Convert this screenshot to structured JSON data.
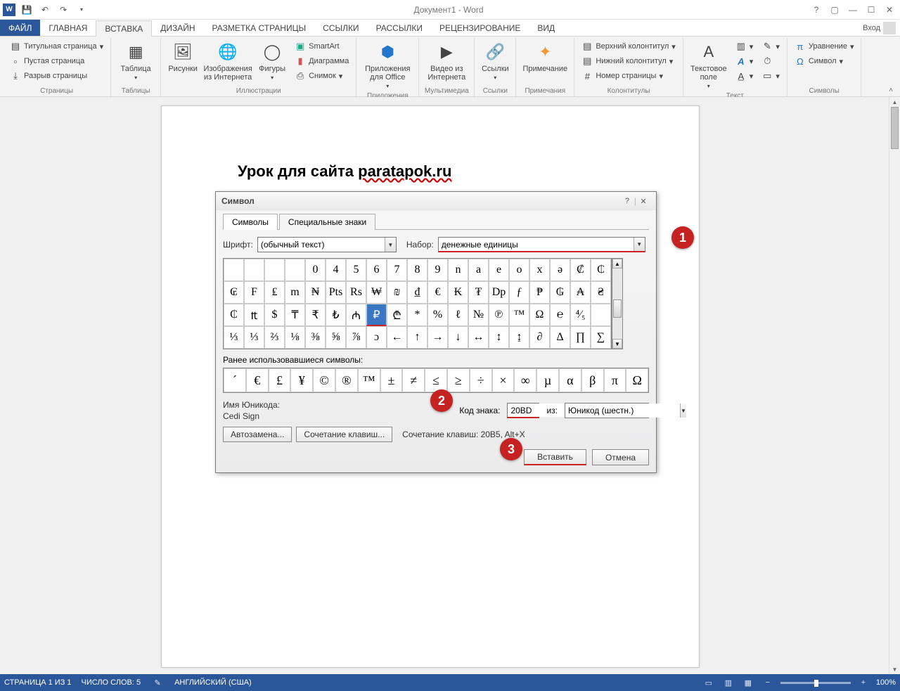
{
  "title": "Документ1 - Word",
  "signin": "Вход",
  "tabs": [
    "ФАЙЛ",
    "ГЛАВНАЯ",
    "ВСТАВКА",
    "ДИЗАЙН",
    "РАЗМЕТКА СТРАНИЦЫ",
    "ССЫЛКИ",
    "РАССЫЛКИ",
    "РЕЦЕНЗИРОВАНИЕ",
    "ВИД"
  ],
  "active_tab": 2,
  "ribbon": {
    "g1": {
      "label": "Страницы",
      "items": [
        "Титульная страница",
        "Пустая страница",
        "Разрыв страницы"
      ]
    },
    "g2": {
      "label": "Таблицы",
      "btn": "Таблица"
    },
    "g3": {
      "label": "Иллюстрации",
      "b1": "Рисунки",
      "b2": "Изображения из Интернета",
      "b3": "Фигуры",
      "i1": "SmartArt",
      "i2": "Диаграмма",
      "i3": "Снимок"
    },
    "g4": {
      "label": "Приложения",
      "btn": "Приложения для Office"
    },
    "g5": {
      "label": "Мультимедиа",
      "btn": "Видео из Интернета"
    },
    "g6": {
      "label": "Ссылки",
      "btn": "Ссылки"
    },
    "g7": {
      "label": "Примечания",
      "btn": "Примечание"
    },
    "g8": {
      "label": "Колонтитулы",
      "i1": "Верхний колонтитул",
      "i2": "Нижний колонтитул",
      "i3": "Номер страницы"
    },
    "g9": {
      "label": "Текст",
      "btn": "Текстовое поле"
    },
    "g10": {
      "label": "Символы",
      "i1": "Уравнение",
      "i2": "Символ"
    }
  },
  "doc": {
    "text1": "Урок для сайта ",
    "text2": "paratapok.ru"
  },
  "dialog": {
    "title": "Символ",
    "tabs": [
      "Символы",
      "Специальные знаки"
    ],
    "font_label": "Шрифт:",
    "font_value": "(обычный текст)",
    "set_label": "Набор:",
    "set_value": "денежные единицы",
    "grid": [
      [
        "",
        "",
        "",
        "",
        "0",
        "4",
        "5",
        "6",
        "7",
        "8",
        "9",
        "n",
        "a",
        "e",
        "o",
        "x",
        "ə",
        "₡",
        "₵"
      ],
      [
        "₢",
        "F",
        "₤",
        "m",
        "₦",
        "Pts",
        "Rs",
        "₩",
        "₪",
        "₫",
        "€",
        "₭",
        "₮",
        "Dp",
        "ƒ",
        "₱",
        "₲",
        "₳",
        "₴"
      ],
      [
        "₵",
        "₶",
        "$",
        "₸",
        "₹",
        "₺",
        "₼",
        "₾",
        "₾",
        "*",
        "%",
        "ℓ",
        "№",
        "℗",
        "™",
        "Ω",
        "℮",
        "⁴⁄₅",
        ""
      ],
      [
        "⅓",
        "⅓",
        "⅔",
        "⅛",
        "⅜",
        "⅝",
        "⅞",
        "ɔ",
        "←",
        "↑",
        "→",
        "↓",
        "↔",
        "↕",
        "↨",
        "∂",
        "Δ",
        "∏",
        "∑"
      ]
    ],
    "grid_selected": {
      "row": 2,
      "col": 7,
      "char": "₽"
    },
    "recent_label": "Ранее использовавшиеся символы:",
    "recent": [
      "´",
      "€",
      "£",
      "¥",
      "©",
      "®",
      "™",
      "±",
      "≠",
      "≤",
      "≥",
      "÷",
      "×",
      "∞",
      "µ",
      "α",
      "β",
      "π",
      "Ω"
    ],
    "uname_label": "Имя Юникода:",
    "uname_value": "Cedi Sign",
    "code_label": "Код знака:",
    "code_value": "20BD",
    "from_label": "из:",
    "from_value": "Юникод (шестн.)",
    "autocorrect": "Автозамена...",
    "shortcut_btn": "Сочетание клавиш...",
    "shortcut_text": "Сочетание клавиш: 20B5, Alt+X",
    "insert": "Вставить",
    "cancel": "Отмена"
  },
  "callouts": [
    "1",
    "2",
    "3"
  ],
  "status": {
    "page": "СТРАНИЦА 1 ИЗ 1",
    "words": "ЧИСЛО СЛОВ: 5",
    "lang": "АНГЛИЙСКИЙ (США)",
    "zoom": "100%"
  }
}
